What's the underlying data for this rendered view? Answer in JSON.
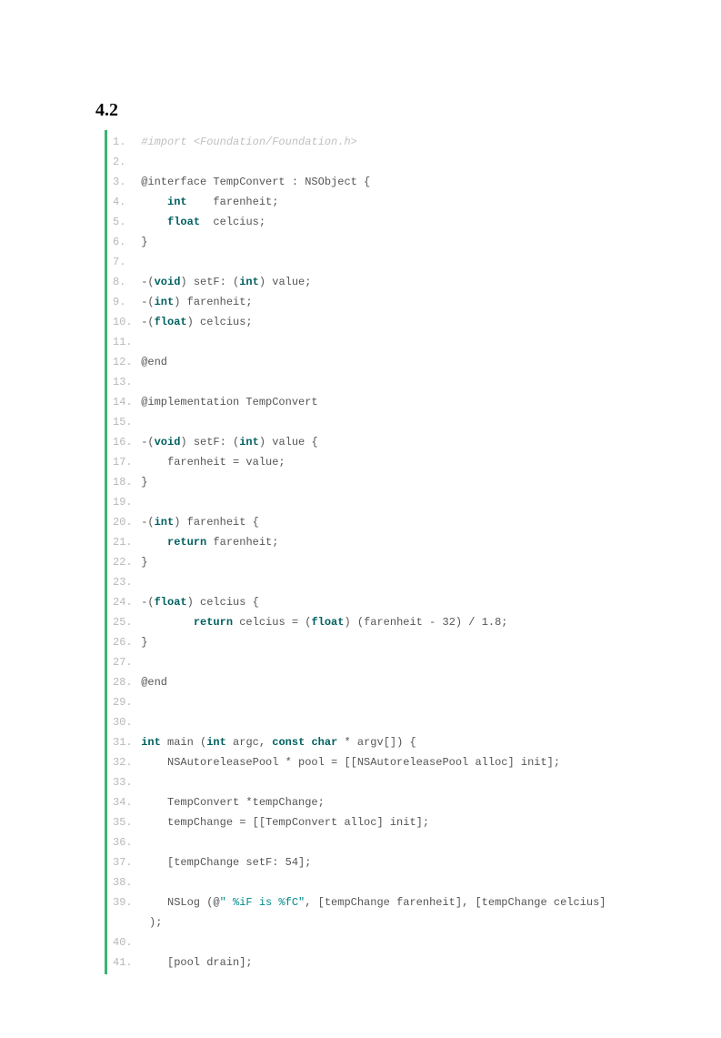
{
  "heading": "4.2",
  "code": {
    "lines": [
      {
        "num": "1.",
        "tokens": [
          {
            "t": " ",
            "c": ""
          },
          {
            "t": "#import <Foundation/Foundation.h>",
            "c": "c-import"
          }
        ]
      },
      {
        "num": "2.",
        "tokens": []
      },
      {
        "num": "3.",
        "tokens": [
          {
            "t": " @interface TempConvert : NSObject {",
            "c": ""
          }
        ]
      },
      {
        "num": "4.",
        "tokens": [
          {
            "t": "     ",
            "c": ""
          },
          {
            "t": "int",
            "c": "c-keyword"
          },
          {
            "t": "    farenheit;",
            "c": ""
          }
        ]
      },
      {
        "num": "5.",
        "tokens": [
          {
            "t": "     ",
            "c": ""
          },
          {
            "t": "float",
            "c": "c-keyword"
          },
          {
            "t": "  celcius;",
            "c": ""
          }
        ]
      },
      {
        "num": "6.",
        "tokens": [
          {
            "t": " }",
            "c": ""
          }
        ]
      },
      {
        "num": "7.",
        "tokens": []
      },
      {
        "num": "8.",
        "tokens": [
          {
            "t": " -(",
            "c": ""
          },
          {
            "t": "void",
            "c": "c-keyword"
          },
          {
            "t": ") setF: (",
            "c": ""
          },
          {
            "t": "int",
            "c": "c-keyword"
          },
          {
            "t": ") value;",
            "c": ""
          }
        ]
      },
      {
        "num": "9.",
        "tokens": [
          {
            "t": " -(",
            "c": ""
          },
          {
            "t": "int",
            "c": "c-keyword"
          },
          {
            "t": ") farenheit;",
            "c": ""
          }
        ]
      },
      {
        "num": "10.",
        "tokens": [
          {
            "t": " -(",
            "c": ""
          },
          {
            "t": "float",
            "c": "c-keyword"
          },
          {
            "t": ") celcius;",
            "c": ""
          }
        ]
      },
      {
        "num": "11.",
        "tokens": []
      },
      {
        "num": "12.",
        "tokens": [
          {
            "t": " @end",
            "c": ""
          }
        ]
      },
      {
        "num": "13.",
        "tokens": []
      },
      {
        "num": "14.",
        "tokens": [
          {
            "t": " @implementation TempConvert",
            "c": ""
          }
        ]
      },
      {
        "num": "15.",
        "tokens": []
      },
      {
        "num": "16.",
        "tokens": [
          {
            "t": " -(",
            "c": ""
          },
          {
            "t": "void",
            "c": "c-keyword"
          },
          {
            "t": ") setF: (",
            "c": ""
          },
          {
            "t": "int",
            "c": "c-keyword"
          },
          {
            "t": ") value {",
            "c": ""
          }
        ]
      },
      {
        "num": "17.",
        "tokens": [
          {
            "t": "     farenheit = value;",
            "c": ""
          }
        ]
      },
      {
        "num": "18.",
        "tokens": [
          {
            "t": " }",
            "c": ""
          }
        ]
      },
      {
        "num": "19.",
        "tokens": []
      },
      {
        "num": "20.",
        "tokens": [
          {
            "t": " -(",
            "c": ""
          },
          {
            "t": "int",
            "c": "c-keyword"
          },
          {
            "t": ") farenheit {",
            "c": ""
          }
        ]
      },
      {
        "num": "21.",
        "tokens": [
          {
            "t": "     ",
            "c": ""
          },
          {
            "t": "return",
            "c": "c-keyword"
          },
          {
            "t": " farenheit;",
            "c": ""
          }
        ]
      },
      {
        "num": "22.",
        "tokens": [
          {
            "t": " }",
            "c": ""
          }
        ]
      },
      {
        "num": "23.",
        "tokens": []
      },
      {
        "num": "24.",
        "tokens": [
          {
            "t": " -(",
            "c": ""
          },
          {
            "t": "float",
            "c": "c-keyword"
          },
          {
            "t": ") celcius {",
            "c": ""
          }
        ]
      },
      {
        "num": "25.",
        "tokens": [
          {
            "t": "         ",
            "c": ""
          },
          {
            "t": "return",
            "c": "c-keyword"
          },
          {
            "t": " celcius = (",
            "c": ""
          },
          {
            "t": "float",
            "c": "c-keyword"
          },
          {
            "t": ") (farenheit - 32) / 1.8;",
            "c": ""
          }
        ]
      },
      {
        "num": "26.",
        "tokens": [
          {
            "t": " }",
            "c": ""
          }
        ]
      },
      {
        "num": "27.",
        "tokens": []
      },
      {
        "num": "28.",
        "tokens": [
          {
            "t": " @end",
            "c": ""
          }
        ]
      },
      {
        "num": "29.",
        "tokens": []
      },
      {
        "num": "30.",
        "tokens": []
      },
      {
        "num": "31.",
        "tokens": [
          {
            "t": " ",
            "c": ""
          },
          {
            "t": "int",
            "c": "c-keyword"
          },
          {
            "t": " main (",
            "c": ""
          },
          {
            "t": "int",
            "c": "c-keyword"
          },
          {
            "t": " argc, ",
            "c": ""
          },
          {
            "t": "const",
            "c": "c-keyword"
          },
          {
            "t": " ",
            "c": ""
          },
          {
            "t": "char",
            "c": "c-keyword"
          },
          {
            "t": " * argv[]) {",
            "c": ""
          }
        ]
      },
      {
        "num": "32.",
        "tokens": [
          {
            "t": "     NSAutoreleasePool * pool = [[NSAutoreleasePool alloc] init];",
            "c": ""
          }
        ]
      },
      {
        "num": "33.",
        "tokens": []
      },
      {
        "num": "34.",
        "tokens": [
          {
            "t": "     TempConvert *tempChange;",
            "c": ""
          }
        ]
      },
      {
        "num": "35.",
        "tokens": [
          {
            "t": "     tempChange = [[TempConvert alloc] init];",
            "c": ""
          }
        ]
      },
      {
        "num": "36.",
        "tokens": []
      },
      {
        "num": "37.",
        "tokens": [
          {
            "t": "     [tempChange setF: 54];",
            "c": ""
          }
        ]
      },
      {
        "num": "38.",
        "tokens": []
      },
      {
        "num": "39.",
        "tokens": [
          {
            "t": "     NSLog (@",
            "c": ""
          },
          {
            "t": "\" %iF is %fC\"",
            "c": "c-string"
          },
          {
            "t": ", [tempChange farenheit], [tempChange celcius]",
            "c": ""
          }
        ]
      },
      {
        "num": "",
        "continuation": true,
        "tokens": [
          {
            "t": ");",
            "c": ""
          }
        ]
      },
      {
        "num": "40.",
        "tokens": []
      },
      {
        "num": "41.",
        "tokens": [
          {
            "t": "     [pool drain];",
            "c": ""
          }
        ]
      }
    ]
  }
}
